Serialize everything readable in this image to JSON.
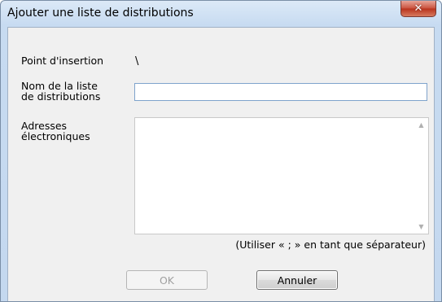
{
  "window": {
    "title": "Ajouter une liste de distributions",
    "close_glyph": "✕"
  },
  "form": {
    "insertion_point_label": "Point d'insertion",
    "insertion_point_value": "\\",
    "list_name_label_line1": "Nom de la liste",
    "list_name_label_line2": "de distributions",
    "list_name_value": "",
    "addresses_label_line1": "Adresses",
    "addresses_label_line2": "électroniques",
    "addresses_value": "",
    "separator_hint": "(Utiliser « ; » en tant que séparateur)"
  },
  "buttons": {
    "ok_label": "OK",
    "ok_enabled": false,
    "cancel_label": "Annuler"
  },
  "icons": {
    "close": "close-icon",
    "scroll_up": "scroll-up-arrow-icon",
    "scroll_down": "scroll-down-arrow-icon"
  },
  "colors": {
    "close_button": "#c9503c",
    "titlebar": "#c7dbf1",
    "dialog_background": "#f0f0f0"
  }
}
